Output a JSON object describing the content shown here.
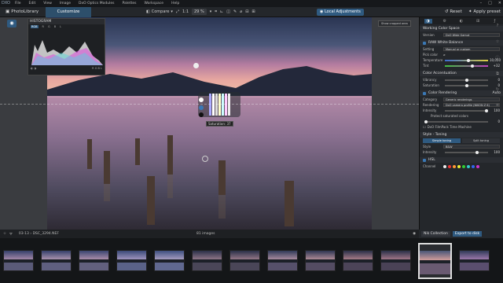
{
  "app": {
    "logo": "DXO"
  },
  "menu": [
    "File",
    "Edit",
    "View",
    "Image",
    "DxO Optics Modules",
    "Palettes",
    "Workspace",
    "Help"
  ],
  "window_controls": [
    "–",
    "□",
    "✕"
  ],
  "toolbar": {
    "photolibrary": "PhotoLibrary",
    "customize": "Customize",
    "compare": "Compare",
    "ratio": "1:1",
    "zoom": "29 %",
    "local_adjustments": "Local Adjustments",
    "reset": "Reset",
    "apply_preset": "Apply preset"
  },
  "viewer": {
    "show_cropped": "Show cropped area",
    "saturation_tip": "Saturation: 37"
  },
  "histogram": {
    "title": "HISTOGRAM",
    "modes": [
      "RGB",
      "R",
      "G",
      "B",
      "L"
    ],
    "bottom_left": "◐ ◑",
    "bottom_right": "R  G  B  L"
  },
  "filmstrip_bar": {
    "path": "03-13 › DSC_3294.NEF",
    "count": "81 images"
  },
  "panel_bottom": {
    "nik": "Nik Collection",
    "export": "Export to disk"
  },
  "panel": {
    "tabs": [
      "◑",
      "⚙",
      "◐",
      "⊞",
      "ƒ"
    ],
    "color_space": {
      "title": "Working Color Space",
      "version_label": "Version",
      "version": "DxO Wide Gamut"
    },
    "wb": {
      "title": "RAW White Balance",
      "setting_label": "Setting",
      "setting": "Manual or custom",
      "pick": "Pick color",
      "temp_label": "Temperature",
      "temp_val": "10,050",
      "tint_label": "Tint",
      "tint_val": "+32"
    },
    "accent": {
      "title": "Color Accentuation",
      "vibrancy_label": "Vibrancy",
      "vibrancy_val": "0",
      "saturation_label": "Saturation",
      "saturation_val": "0"
    },
    "rendering": {
      "title": "Color Rendering",
      "mode": "Auto",
      "category_label": "Category",
      "category": "Generic renderings",
      "rendering_label": "Rendering",
      "rendering": "DxO camera profile (NIKON Z 6)",
      "intensity_label": "Intensity",
      "intensity_val": "100",
      "protect": "Protect saturated colors",
      "protect_val": "0",
      "filmpack": "DxO FilmPack Time Machine"
    },
    "toning": {
      "title": "Style - Toning",
      "simple": "Simple toning",
      "split": "Split toning",
      "style_label": "Style",
      "style": "B&W",
      "intensity_label": "Intensity",
      "intensity_val": "100"
    },
    "hsl": {
      "title": "HSL",
      "channel_label": "Channel"
    }
  },
  "colors": {
    "accent": "#2f5a80",
    "panel": "#24272b"
  }
}
